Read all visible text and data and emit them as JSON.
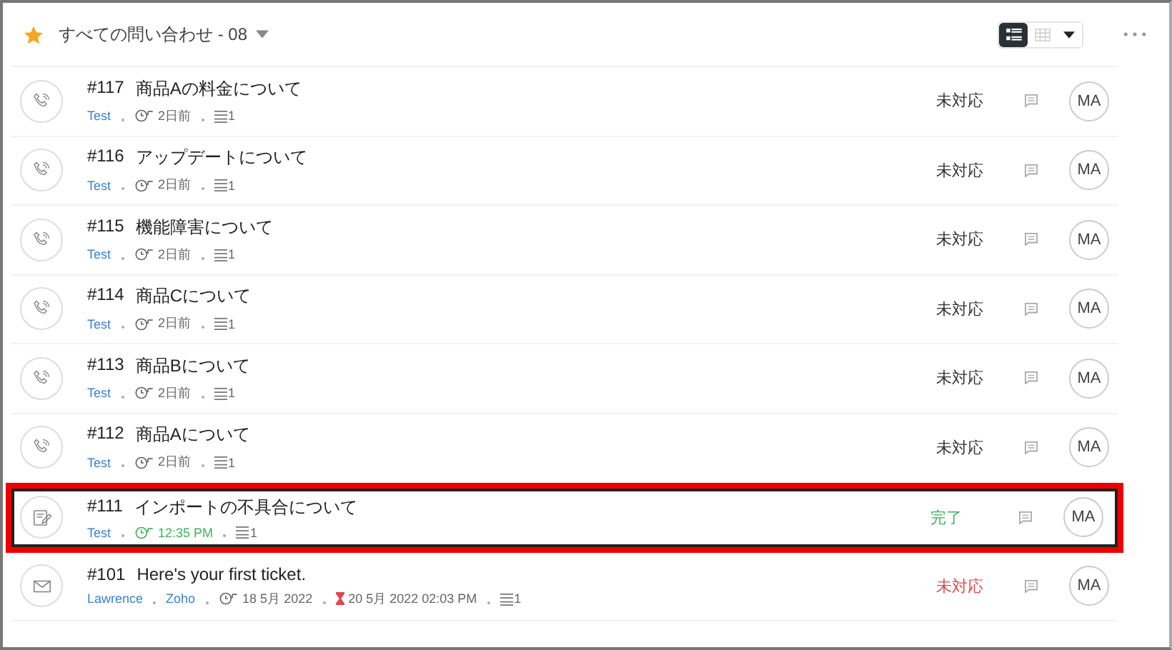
{
  "header": {
    "title": "すべての問い合わせ - 08",
    "view_toggle": [
      {
        "kind": "list",
        "selected": true
      },
      {
        "kind": "table",
        "selected": false
      }
    ]
  },
  "tickets": [
    {
      "kind": "phone",
      "number": "#117",
      "subject": "商品Aの料金について",
      "contacts": [
        "Test"
      ],
      "time": {
        "text": "2日前",
        "kind": "created"
      },
      "threads": "1",
      "status": {
        "text": "未対応",
        "kind": "open"
      },
      "agent": "MA",
      "highlighted": false
    },
    {
      "kind": "phone",
      "number": "#116",
      "subject": "アップデートについて",
      "contacts": [
        "Test"
      ],
      "time": {
        "text": "2日前",
        "kind": "created"
      },
      "threads": "1",
      "status": {
        "text": "未対応",
        "kind": "open"
      },
      "agent": "MA",
      "highlighted": false
    },
    {
      "kind": "phone",
      "number": "#115",
      "subject": "機能障害について",
      "contacts": [
        "Test"
      ],
      "time": {
        "text": "2日前",
        "kind": "created"
      },
      "threads": "1",
      "status": {
        "text": "未対応",
        "kind": "open"
      },
      "agent": "MA",
      "highlighted": false
    },
    {
      "kind": "phone",
      "number": "#114",
      "subject": "商品Cについて",
      "contacts": [
        "Test"
      ],
      "time": {
        "text": "2日前",
        "kind": "created"
      },
      "threads": "1",
      "status": {
        "text": "未対応",
        "kind": "open"
      },
      "agent": "MA",
      "highlighted": false
    },
    {
      "kind": "phone",
      "number": "#113",
      "subject": "商品Bについて",
      "contacts": [
        "Test"
      ],
      "time": {
        "text": "2日前",
        "kind": "created"
      },
      "threads": "1",
      "status": {
        "text": "未対応",
        "kind": "open"
      },
      "agent": "MA",
      "highlighted": false
    },
    {
      "kind": "phone",
      "number": "#112",
      "subject": "商品Aについて",
      "contacts": [
        "Test"
      ],
      "time": {
        "text": "2日前",
        "kind": "created"
      },
      "threads": "1",
      "status": {
        "text": "未対応",
        "kind": "open"
      },
      "agent": "MA",
      "highlighted": false
    },
    {
      "kind": "web",
      "number": "#111",
      "subject": "インポートの不具合について",
      "contacts": [
        "Test"
      ],
      "time": {
        "text": "12:35 PM",
        "kind": "closed"
      },
      "threads": "1",
      "status": {
        "text": "完了",
        "kind": "closed"
      },
      "agent": "MA",
      "highlighted": true
    },
    {
      "kind": "email",
      "number": "#101",
      "subject": "Here's your first ticket.",
      "contacts": [
        "Lawrence",
        "Zoho"
      ],
      "time": {
        "text": "18 5月 2022",
        "kind": "created"
      },
      "due": "20 5月 2022 02:03 PM",
      "threads": "1",
      "status": {
        "text": "未対応",
        "kind": "overdue"
      },
      "agent": "MA",
      "highlighted": false
    }
  ]
}
